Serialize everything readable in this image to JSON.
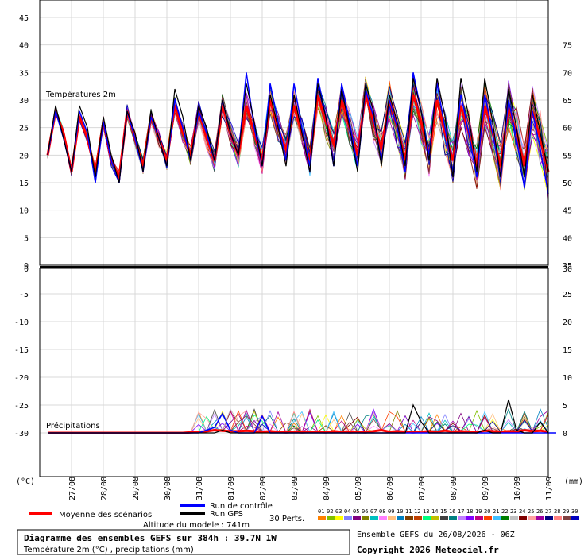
{
  "chart_data": {
    "type": "line",
    "x": [
      "27/08",
      "28/08",
      "29/08",
      "30/08",
      "31/08",
      "01/09",
      "02/09",
      "03/09",
      "04/09",
      "05/09",
      "06/09",
      "07/09",
      "08/09",
      "09/09",
      "10/09",
      "11/09"
    ],
    "panels": [
      {
        "title": "Températures 2m",
        "ylim_left": [
          0,
          45
        ],
        "yticks_left": [
          "0",
          "5",
          "10",
          "15",
          "20",
          "25",
          "30",
          "35",
          "40",
          "45"
        ],
        "yticks_right": [
          "35",
          "40",
          "45",
          "50",
          "55",
          "60",
          "65",
          "70",
          "75"
        ],
        "series": [
          {
            "name": "Moyenne des scénarios",
            "color": "#ff0000",
            "values": [
              20,
              28,
              24,
              17,
              27,
              23,
              17,
              26,
              19,
              16,
              28,
              23,
              18,
              27,
              23,
              19,
              29,
              24,
              20,
              28,
              23,
              19,
              29,
              24,
              20,
              29,
              24,
              19,
              30,
              25,
              21,
              29,
              24,
              19,
              31,
              26,
              22,
              30,
              25,
              20,
              31,
              26,
              21,
              30,
              25,
              19,
              31,
              26,
              20,
              30,
              24,
              19,
              29,
              24,
              18,
              29,
              24,
              18,
              29,
              24,
              18,
              28,
              23,
              17
            ]
          },
          {
            "name": "Run de contrôle",
            "color": "#0000ff",
            "values": [
              20,
              28,
              23,
              17,
              28,
              24,
              15,
              26,
              19,
              15,
              28,
              23,
              17,
              27,
              23,
              18,
              30,
              25,
              19,
              28,
              24,
              19,
              30,
              24,
              20,
              35,
              25,
              18,
              33,
              26,
              19,
              33,
              25,
              18,
              34,
              27,
              18,
              33,
              26,
              18,
              32,
              27,
              19,
              30,
              25,
              17,
              35,
              28,
              20,
              33,
              25,
              17,
              31,
              24,
              16,
              31,
              24,
              16,
              30,
              23,
              14,
              28,
              21,
              13
            ]
          },
          {
            "name": "Run GFS",
            "color": "#000000",
            "values": [
              20,
              29,
              23,
              17,
              29,
              25,
              16,
              27,
              20,
              15,
              28,
              24,
              17,
              28,
              23,
              18,
              32,
              27,
              19,
              29,
              25,
              19,
              30,
              24,
              20,
              33,
              26,
              18,
              31,
              25,
              18,
              31,
              24,
              17,
              33,
              27,
              18,
              32,
              25,
              17,
              33,
              28,
              18,
              31,
              26,
              18,
              34,
              28,
              19,
              34,
              27,
              16,
              34,
              27,
              17,
              34,
              26,
              16,
              32,
              25,
              16,
              31,
              24,
              17
            ]
          }
        ]
      },
      {
        "title": "Précipitations",
        "ylim_left": [
          -30,
          0
        ],
        "yticks_left": [
          "-30",
          "-25",
          "-20",
          "-15",
          "-10",
          "-5",
          "0"
        ],
        "yticks_right": [
          "0",
          "5",
          "10",
          "15",
          "20",
          "25",
          "30"
        ],
        "series": [
          {
            "name": "Moyenne des scénarios",
            "color": "#ff0000",
            "values": [
              0,
              0,
              0,
              0,
              0,
              0,
              0,
              0,
              0,
              0,
              0,
              0,
              0,
              0,
              0,
              0,
              0,
              0,
              0.1,
              0.2,
              0.3,
              0.5,
              0.4,
              0.3,
              0.3,
              0.4,
              0.3,
              0.2,
              0.3,
              0.2,
              0.1,
              0.2,
              0.1,
              0.2,
              0.2,
              0.1,
              0.3,
              0.2,
              0.1,
              0.2,
              0.1,
              0.3,
              0.5,
              0.2,
              0.3,
              0.2,
              0.1,
              0.2,
              0.3,
              0.2,
              0.4,
              0.2,
              0.3,
              0.2,
              0.1,
              0.4,
              0.3,
              0.2,
              0.3,
              0.2,
              0.5,
              0.3,
              0.4,
              0.2
            ]
          },
          {
            "name": "Run de contrôle",
            "color": "#0000ff",
            "values": [
              0,
              0,
              0,
              0,
              0,
              0,
              0,
              0,
              0,
              0,
              0,
              0,
              0,
              0,
              0,
              0,
              0,
              0,
              0,
              0,
              0.5,
              1,
              3.5,
              0.5,
              0,
              0,
              0,
              3,
              0,
              0,
              0,
              0,
              0,
              0,
              0,
              0,
              0,
              0,
              0,
              0,
              0,
              0,
              0,
              0,
              0,
              0,
              0,
              0,
              0,
              0,
              0,
              0,
              0,
              0,
              0,
              0,
              0,
              0,
              0,
              0,
              0,
              0,
              0,
              0,
              0
            ]
          },
          {
            "name": "Run GFS",
            "color": "#000000",
            "values": [
              0,
              0,
              0,
              0,
              0,
              0,
              0,
              0,
              0,
              0,
              0,
              0,
              0,
              0,
              0,
              0,
              0,
              0,
              0,
              0,
              0,
              0,
              0.5,
              0,
              0,
              0,
              0,
              0,
              0,
              0,
              0,
              0,
              0,
              0,
              0,
              0,
              0,
              0,
              0,
              0,
              0,
              0,
              0,
              0,
              0,
              0,
              5,
              2,
              0,
              0,
              0,
              0,
              0,
              0,
              0,
              0.5,
              0,
              0,
              6,
              0.5,
              0,
              0,
              2,
              0
            ]
          }
        ]
      }
    ],
    "ensemble": {
      "label": "30 Perts.",
      "count": 30,
      "colors": [
        "#ff8000",
        "#80c000",
        "#ffff00",
        "#8080ff",
        "#800080",
        "#808000",
        "#00c0c0",
        "#ff80ff",
        "#ffc080",
        "#0080c0",
        "#804000",
        "#c04000",
        "#00ff80",
        "#c0c000",
        "#404040",
        "#008080",
        "#c080ff",
        "#8000ff",
        "#c00080",
        "#ff4000",
        "#40c0ff",
        "#008000",
        "#c0c0c0",
        "#800000",
        "#ffa0a0",
        "#a000a0",
        "#000080",
        "#ff8080",
        "#804040",
        "#0000c0"
      ]
    },
    "left_unit": "(°C)",
    "right_unit": "(mm)"
  },
  "legend": {
    "mean": "Moyenne des scénarios",
    "control": "Run de contrôle",
    "gfs": "Run GFS",
    "perts": "30 Perts.",
    "altitude": "Altitude du modele : 741m"
  },
  "footer": {
    "title": "Diagramme des ensembles GEFS sur 384h : 39.7N 1W",
    "subtitle": "Température 2m (°C) , précipitations (mm)",
    "ensemble_run": "Ensemble GEFS du 26/08/2026 - 06Z",
    "copyright": "Copyright 2026 Meteociel.fr"
  }
}
